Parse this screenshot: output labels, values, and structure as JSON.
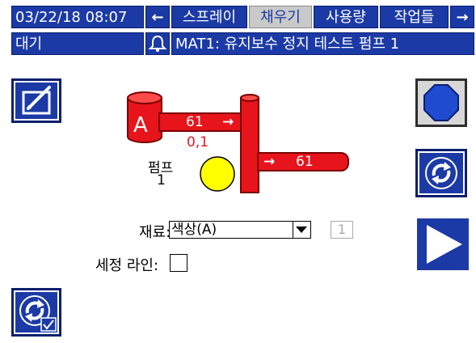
{
  "topbar": {
    "datetime": "03/22/18 08:07",
    "tabs": [
      "스프레이",
      "채우기",
      "사용량",
      "작업들"
    ],
    "active_tab": "채우기",
    "left_arrow": "←",
    "right_arrow": "→"
  },
  "statusbar": {
    "status": "대기",
    "alarm_message": "MAT1: 유지보수 정지 테스트 펌프 1"
  },
  "diagram": {
    "tank_letter": "A",
    "inlet_value": "61",
    "inlet_pressure": "0,1",
    "outlet_value": "61",
    "pump_label": "펌프",
    "pump_number": "1",
    "arrow": "→"
  },
  "form": {
    "material_label": "재료:",
    "material_value": "색상(A)",
    "material_number": "1",
    "set_line_label": "세정 라인:"
  },
  "colors": {
    "header_blue": "#1c3aa6",
    "pipe_red": "#e8141c",
    "pump_yellow": "#ffff00",
    "stop_blue": "#1f4bd0"
  },
  "icons": {
    "edit": "edit-icon",
    "stop": "stop-octagon-icon",
    "cycle": "cycle-arrows-icon",
    "play": "play-icon",
    "cycle_check": "cycle-check-icon",
    "bell": "bell-icon"
  }
}
